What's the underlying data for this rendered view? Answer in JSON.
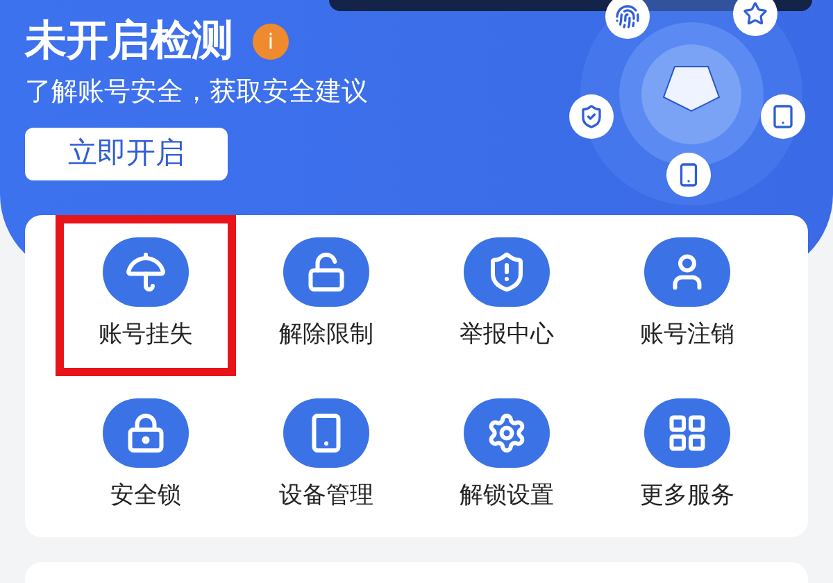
{
  "header": {
    "title": "未开启检测",
    "info_badge": "i",
    "subtitle": "了解账号安全，获取安全建议",
    "button": "立即开启"
  },
  "services": [
    {
      "label": "账号挂失",
      "highlighted": true
    },
    {
      "label": "解除限制",
      "highlighted": false
    },
    {
      "label": "举报中心",
      "highlighted": false
    },
    {
      "label": "账号注销",
      "highlighted": false
    },
    {
      "label": "安全锁",
      "highlighted": false
    },
    {
      "label": "设备管理",
      "highlighted": false
    },
    {
      "label": "解锁设置",
      "highlighted": false
    },
    {
      "label": "更多服务",
      "highlighted": false
    }
  ]
}
